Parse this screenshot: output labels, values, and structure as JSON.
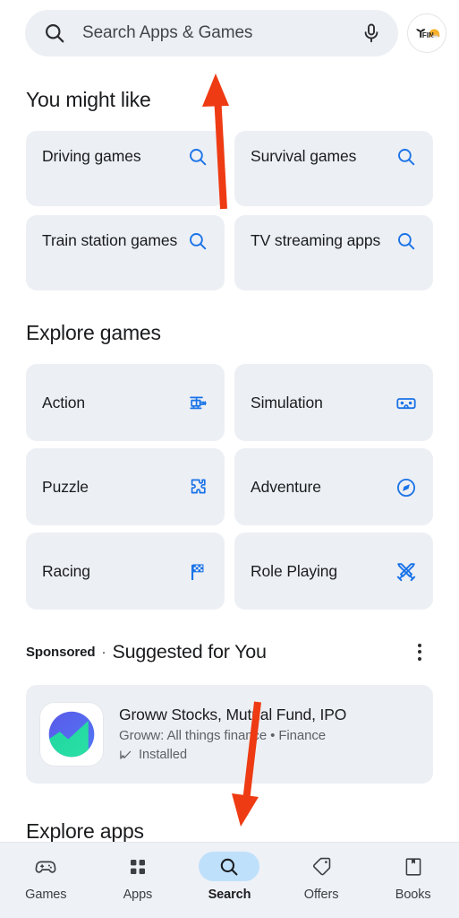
{
  "theme": {
    "accent_blue": "#1a73e8",
    "card_bg": "#eceff4",
    "page_bg": "#ffffff",
    "nav_bg": "#eef1f6",
    "nav_active_pill": "#bfe0fb",
    "text_primary": "#1b1c1e",
    "text_secondary": "#5e6266",
    "annotation_red": "#ee3b13"
  },
  "search": {
    "placeholder": "Search Apps & Games",
    "search_icon": "search-icon",
    "mic_icon": "microphone-icon",
    "avatar_icon": "profile-avatar",
    "avatar_text": "FIN"
  },
  "sections": {
    "you_might_like": {
      "title": "You might like",
      "chips": [
        {
          "label": "Driving games",
          "icon": "search-icon"
        },
        {
          "label": "Survival games",
          "icon": "search-icon"
        },
        {
          "label": "Train station games",
          "icon": "search-icon"
        },
        {
          "label": "TV streaming apps",
          "icon": "search-icon"
        }
      ]
    },
    "explore_games": {
      "title": "Explore games",
      "categories": [
        {
          "label": "Action",
          "icon": "helicopter-icon"
        },
        {
          "label": "Simulation",
          "icon": "vr-cardboard-icon"
        },
        {
          "label": "Puzzle",
          "icon": "puzzle-piece-icon"
        },
        {
          "label": "Adventure",
          "icon": "compass-icon"
        },
        {
          "label": "Racing",
          "icon": "checkered-flag-icon"
        },
        {
          "label": "Role Playing",
          "icon": "crossed-swords-icon"
        }
      ]
    },
    "sponsored": {
      "tag": "Sponsored",
      "separator": "·",
      "heading": "Suggested for You",
      "overflow_icon": "more-vertical-icon",
      "app": {
        "name": "Groww Stocks, Mutual Fund, IPO",
        "subtitle": "Groww: All things finance • Finance",
        "status": "Installed",
        "status_icon": "installed-check-icon",
        "icon": "groww-app-icon"
      }
    },
    "explore_apps": {
      "title": "Explore apps"
    }
  },
  "bottom_nav": {
    "items": [
      {
        "label": "Games",
        "icon": "gamepad-icon",
        "active": false
      },
      {
        "label": "Apps",
        "icon": "grid-apps-icon",
        "active": false
      },
      {
        "label": "Search",
        "icon": "search-icon",
        "active": true
      },
      {
        "label": "Offers",
        "icon": "price-tag-icon",
        "active": false
      },
      {
        "label": "Books",
        "icon": "book-bookmark-icon",
        "active": false
      }
    ]
  },
  "annotations": {
    "arrow_up": {
      "label": "arrow pointing up to search bar",
      "color": "#ee3b13"
    },
    "arrow_down": {
      "label": "arrow pointing down to explore apps",
      "color": "#ee3b13"
    }
  }
}
